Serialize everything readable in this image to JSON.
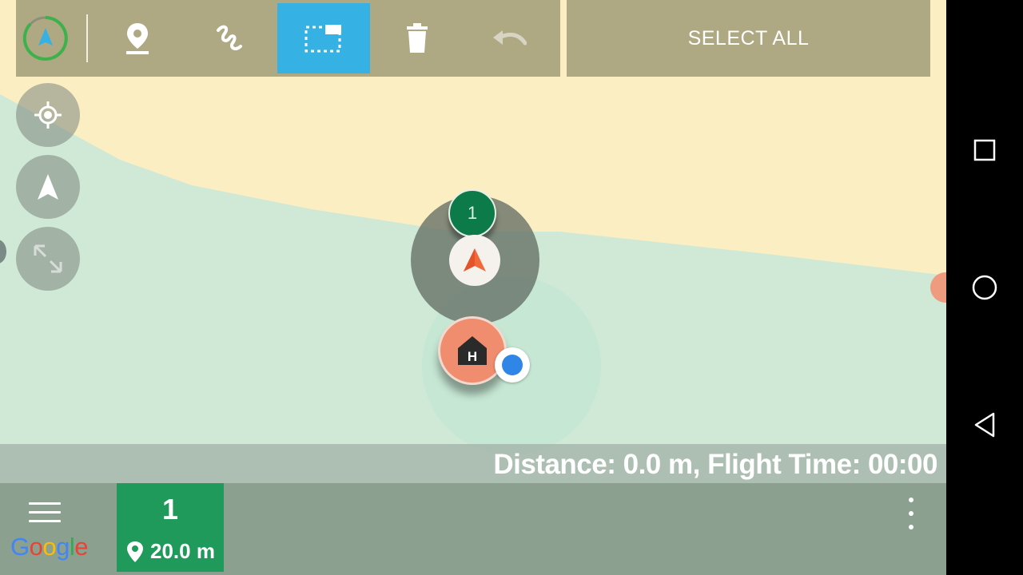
{
  "colors": {
    "toolbar_bg": "#aea883",
    "toolbar_active": "#35b1e4",
    "map_land": "#faeec2",
    "map_water": "#cfe9d6",
    "waypoint_green": "#1f9a5a",
    "home_orange": "#ef8d6e",
    "drone_orange": "#f06a3a",
    "location_blue": "#2f86e6"
  },
  "toolbar": {
    "items": [
      {
        "icon": "compass-navigation-icon",
        "active": false
      },
      {
        "icon": "waypoint-pin-icon",
        "active": false
      },
      {
        "icon": "freehand-path-icon",
        "active": false
      },
      {
        "icon": "select-area-icon",
        "active": true
      },
      {
        "icon": "trash-icon",
        "active": false
      },
      {
        "icon": "undo-icon",
        "active": false
      }
    ],
    "select_all_label": "SELECT ALL"
  },
  "map_controls": [
    {
      "icon": "my-location-icon"
    },
    {
      "icon": "navigation-arrow-icon"
    },
    {
      "icon": "expand-icon"
    }
  ],
  "map": {
    "waypoint_label": "1",
    "home_label": "H"
  },
  "status": {
    "text": "Distance: 0.0 m, Flight Time: 00:00"
  },
  "bottom_bar": {
    "menu_icon": "hamburger-menu-icon",
    "google_letters": [
      {
        "char": "G",
        "color": "#4285f4"
      },
      {
        "char": "o",
        "color": "#ea4335"
      },
      {
        "char": "o",
        "color": "#fbbc05"
      },
      {
        "char": "g",
        "color": "#4285f4"
      },
      {
        "char": "l",
        "color": "#34a853"
      },
      {
        "char": "e",
        "color": "#ea4335"
      }
    ],
    "waypoint_card": {
      "number": "1",
      "altitude": "20.0 m"
    },
    "overflow_icon": "more-vertical-icon"
  },
  "system_nav": [
    {
      "icon": "recent-apps-icon"
    },
    {
      "icon": "home-circle-icon"
    },
    {
      "icon": "back-triangle-icon"
    }
  ]
}
